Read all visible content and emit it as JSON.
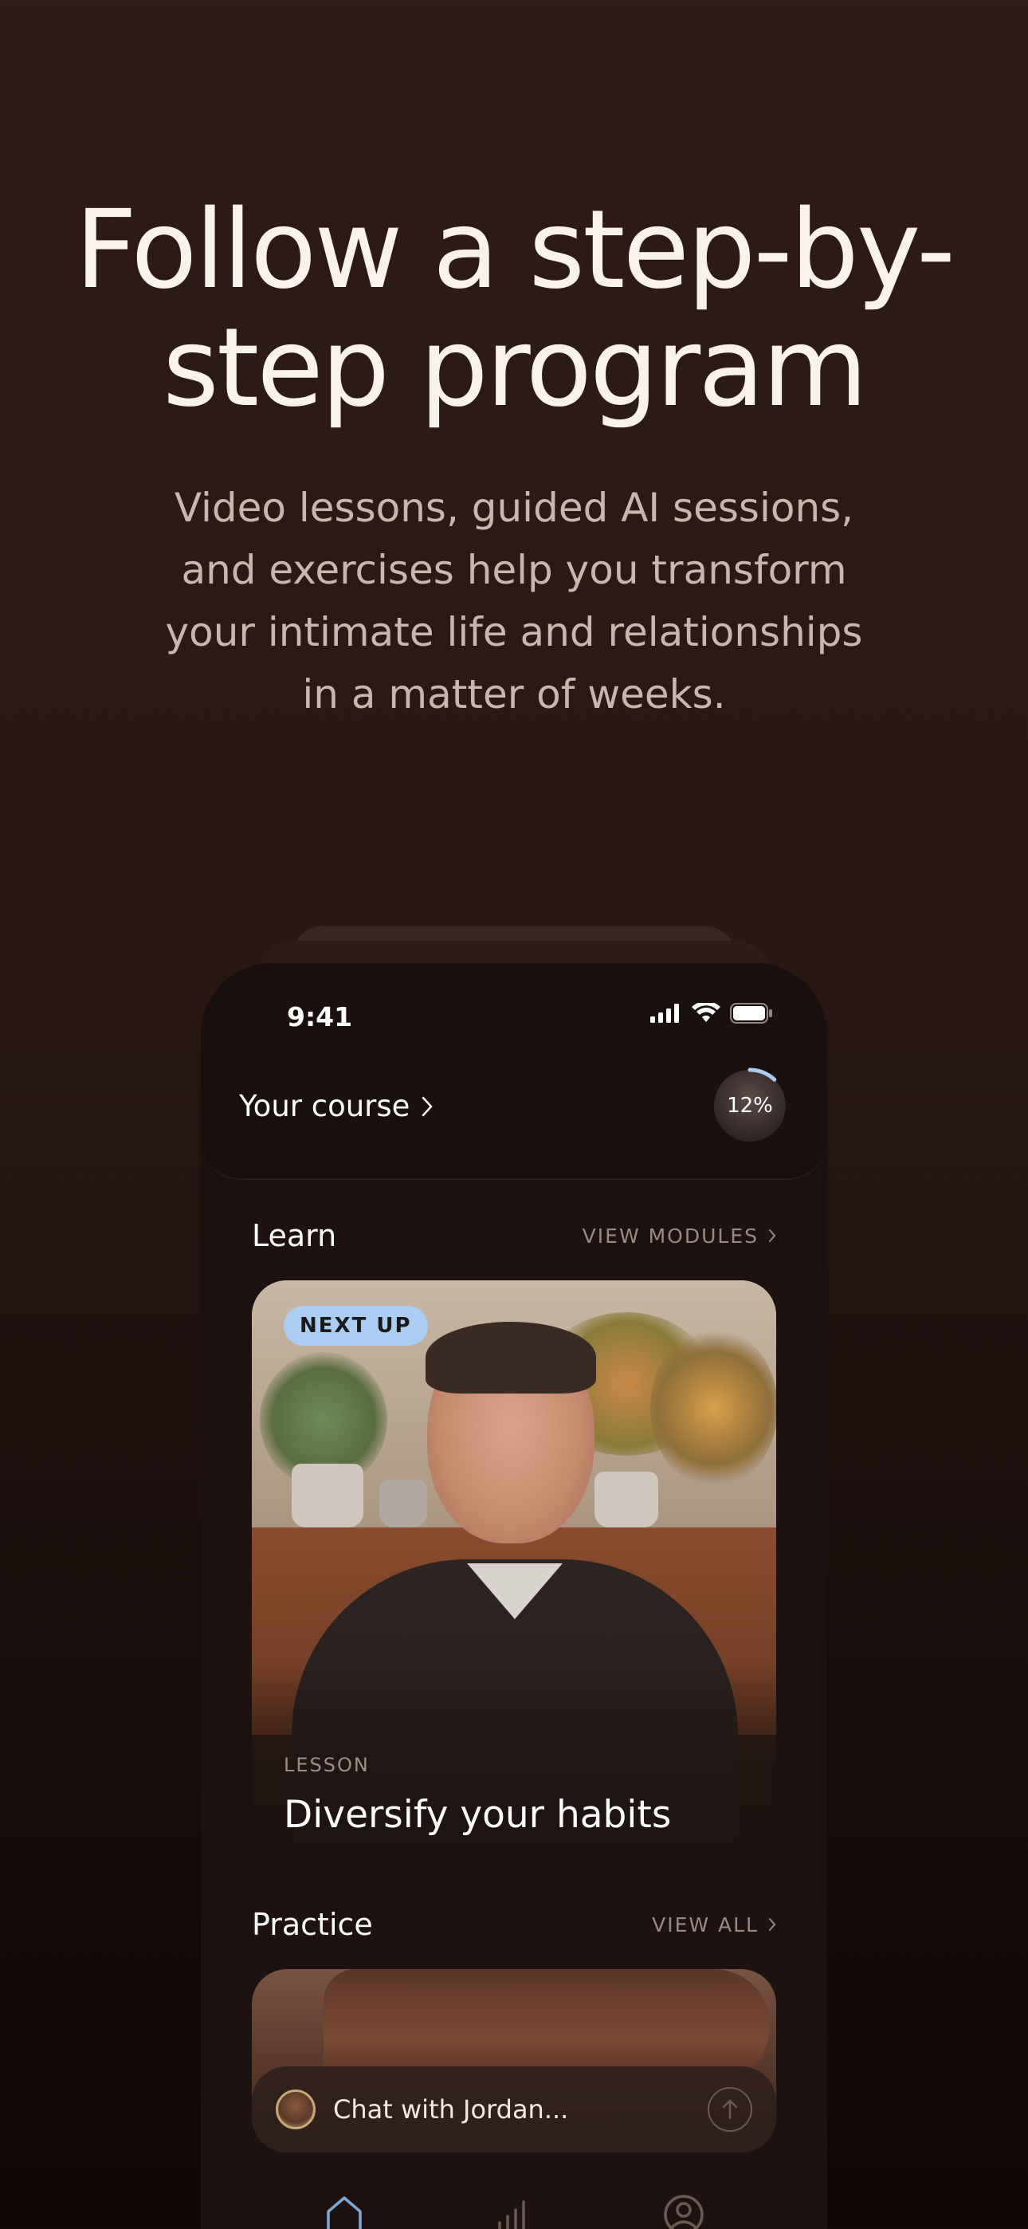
{
  "hero": {
    "headline_line1": "Follow a step-by-",
    "headline_line2": "step program",
    "subtext_line1": "Video lessons, guided AI sessions,",
    "subtext_line2": "and exercises help you transform",
    "subtext_line3": "your intimate life and relationships",
    "subtext_line4": "in a matter of weeks."
  },
  "status_bar": {
    "time": "9:41",
    "icons": [
      "cellular-signal-icon",
      "wifi-icon",
      "battery-icon"
    ]
  },
  "course": {
    "label": "Your course",
    "progress_label": "12%",
    "progress_fraction": 0.12
  },
  "learn": {
    "title": "Learn",
    "link": "VIEW MODULES",
    "card": {
      "badge": "NEXT UP",
      "kicker": "LESSON",
      "title": "Diversify your habits"
    }
  },
  "practice": {
    "title": "Practice",
    "link": "VIEW ALL"
  },
  "chat": {
    "text": "Chat with Jordan..."
  },
  "tabbar": {
    "items": [
      "home-icon",
      "stats-icon",
      "profile-icon"
    ],
    "active_color": "#7fa8d6"
  },
  "colors": {
    "background": "#2e1b17",
    "badge": "#a9cdf3",
    "accent": "#a9cdf3"
  }
}
